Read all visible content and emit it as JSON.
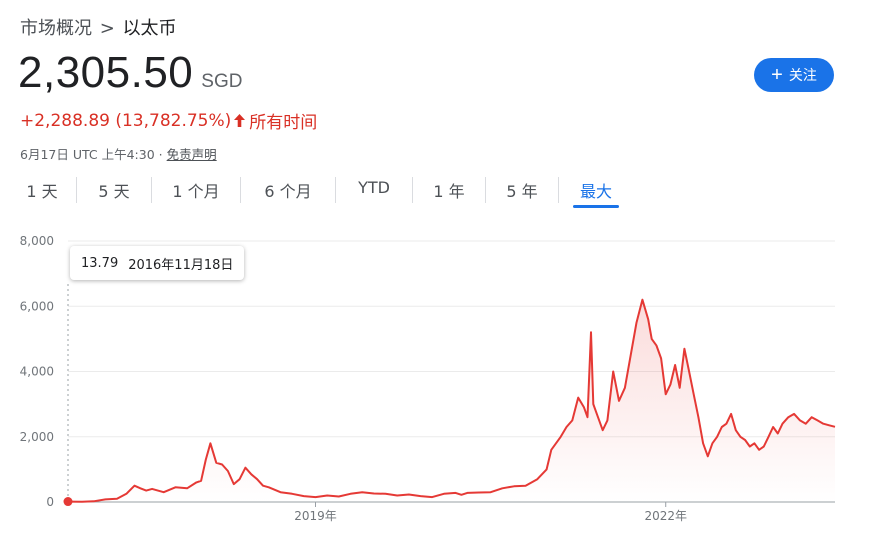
{
  "breadcrumb": {
    "parent": "市场概况",
    "separator": ">",
    "current": "以太币"
  },
  "price": {
    "value": "2,305.50",
    "currency": "SGD"
  },
  "change": {
    "text": "+2,288.89 (13,782.75%)",
    "arrow": "🠕",
    "period": "所有时间"
  },
  "meta": {
    "timestamp": "6月17日 UTC 上午4:30",
    "dot": "·",
    "disclaimer": "免责声明"
  },
  "follow": {
    "plus": "+",
    "label": "关注"
  },
  "tabs": [
    {
      "label": "1 天",
      "active": false
    },
    {
      "label": "5 天",
      "active": false
    },
    {
      "label": "1 个月",
      "active": false
    },
    {
      "label": "6 个月",
      "active": false
    },
    {
      "label": "YTD",
      "active": false
    },
    {
      "label": "1 年",
      "active": false
    },
    {
      "label": "5 年",
      "active": false
    },
    {
      "label": "最大",
      "active": true
    }
  ],
  "tooltip": {
    "value": "13.79",
    "date": "2016年11月18日"
  },
  "colors": {
    "line": "#e53935",
    "accent": "#1a73e8",
    "negative": "#d93025",
    "grid": "#ebebeb"
  },
  "chart_data": {
    "type": "line",
    "ylim": [
      0,
      8000
    ],
    "yticks": [
      0,
      2000,
      4000,
      6000,
      8000
    ],
    "ytick_labels": [
      "0",
      "2,000",
      "4,000",
      "6,000",
      "8,000"
    ],
    "xlim": [
      2016.88,
      2023.45
    ],
    "xticks": [
      {
        "x": 2019.0,
        "label": "2019年"
      },
      {
        "x": 2022.0,
        "label": "2022年"
      }
    ],
    "marker": {
      "x": 2016.88,
      "y": 13.79
    },
    "series": [
      {
        "x": [
          2016.88,
          2017.0,
          2017.1,
          2017.2,
          2017.3,
          2017.38,
          2017.45,
          2017.5,
          2017.55,
          2017.6,
          2017.7,
          2017.8,
          2017.9,
          2017.98,
          2018.02,
          2018.06,
          2018.1,
          2018.15,
          2018.2,
          2018.25,
          2018.3,
          2018.35,
          2018.4,
          2018.45,
          2018.5,
          2018.55,
          2018.6,
          2018.7,
          2018.8,
          2018.9,
          2019.0,
          2019.1,
          2019.2,
          2019.3,
          2019.4,
          2019.5,
          2019.6,
          2019.7,
          2019.8,
          2019.9,
          2020.0,
          2020.1,
          2020.2,
          2020.25,
          2020.3,
          2020.4,
          2020.5,
          2020.6,
          2020.7,
          2020.8,
          2020.9,
          2020.98,
          2021.02,
          2021.06,
          2021.1,
          2021.15,
          2021.2,
          2021.25,
          2021.3,
          2021.33,
          2021.36,
          2021.38,
          2021.42,
          2021.46,
          2021.5,
          2021.55,
          2021.6,
          2021.65,
          2021.7,
          2021.75,
          2021.8,
          2021.85,
          2021.88,
          2021.92,
          2021.96,
          2022.0,
          2022.04,
          2022.08,
          2022.12,
          2022.16,
          2022.2,
          2022.24,
          2022.28,
          2022.32,
          2022.36,
          2022.4,
          2022.44,
          2022.48,
          2022.52,
          2022.56,
          2022.6,
          2022.64,
          2022.68,
          2022.72,
          2022.76,
          2022.8,
          2022.84,
          2022.88,
          2022.92,
          2022.96,
          2023.0,
          2023.05,
          2023.1,
          2023.15,
          2023.2,
          2023.25,
          2023.3,
          2023.35,
          2023.4,
          2023.45
        ],
        "y": [
          13.79,
          10,
          20,
          80,
          100,
          250,
          500,
          420,
          350,
          400,
          300,
          450,
          420,
          600,
          650,
          1300,
          1800,
          1200,
          1150,
          950,
          550,
          700,
          1050,
          850,
          700,
          500,
          450,
          300,
          250,
          180,
          150,
          200,
          170,
          250,
          300,
          260,
          250,
          200,
          230,
          180,
          150,
          250,
          280,
          220,
          280,
          290,
          300,
          420,
          480,
          500,
          700,
          1000,
          1600,
          1800,
          2000,
          2300,
          2500,
          3200,
          2900,
          2600,
          5200,
          3000,
          2600,
          2200,
          2500,
          4000,
          3100,
          3500,
          4500,
          5500,
          6200,
          5600,
          5000,
          4800,
          4400,
          3300,
          3600,
          4200,
          3500,
          4700,
          4000,
          3300,
          2600,
          1800,
          1400,
          1800,
          2000,
          2300,
          2400,
          2700,
          2200,
          2000,
          1900,
          1700,
          1800,
          1600,
          1700,
          2000,
          2300,
          2100,
          2400,
          2600,
          2700,
          2500,
          2400,
          2600,
          2500,
          2400,
          2350,
          2305.5
        ]
      }
    ]
  }
}
